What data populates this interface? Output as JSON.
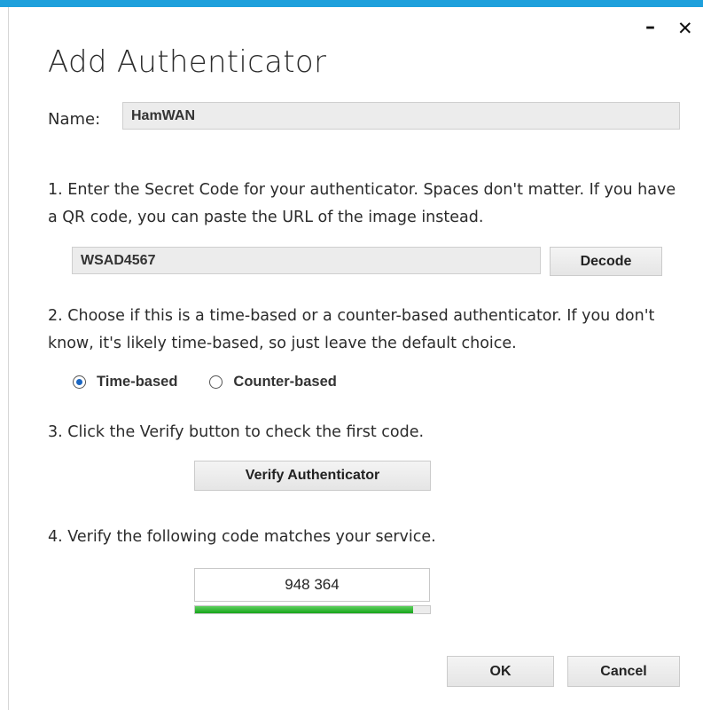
{
  "window": {
    "title": "Add Authenticator",
    "minimize_glyph": "–",
    "close_glyph": "✕",
    "accent_color": "#1ea0dc"
  },
  "name_field": {
    "label": "Name:",
    "value": "HamWAN"
  },
  "step1": {
    "text": "1. Enter the Secret Code for your authenticator. Spaces don't matter. If you have a QR code, you can paste the URL of the image instead.",
    "secret_value": "WSAD4567",
    "decode_label": "Decode"
  },
  "step2": {
    "text": "2. Choose if this is a time-based or a counter-based authenticator. If you don't know, it's likely time-based, so just leave the default choice.",
    "options": [
      {
        "label": "Time-based",
        "selected": true
      },
      {
        "label": "Counter-based",
        "selected": false
      }
    ]
  },
  "step3": {
    "text": "3. Click the Verify button to check the first code.",
    "verify_label": "Verify Authenticator"
  },
  "step4": {
    "text": "4. Verify the following code matches your service.",
    "code": "948 364",
    "progress_percent": 93
  },
  "footer": {
    "ok_label": "OK",
    "cancel_label": "Cancel"
  }
}
